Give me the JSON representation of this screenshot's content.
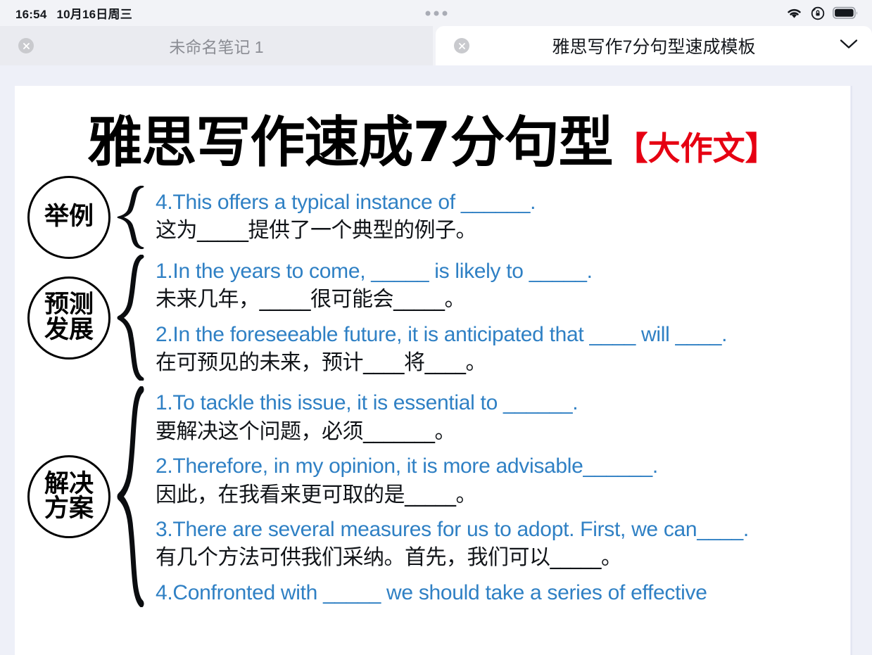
{
  "statusbar": {
    "time": "16:54",
    "date": "10月16日周三",
    "icons": [
      "wifi-icon",
      "rotation-lock-icon",
      "battery-icon"
    ]
  },
  "tabs": [
    {
      "title": "未命名笔记 1",
      "active": false
    },
    {
      "title": "雅思写作7分句型速成模板",
      "active": true
    }
  ],
  "document": {
    "heading_main": "雅思写作速成7分句型",
    "heading_tag": "【大作文】",
    "heading_tag_color": "#e60012",
    "english_color": "#2f80c4",
    "groups": [
      {
        "label_lines": [
          "举例"
        ],
        "lines": [
          {
            "en": "4.This offers a typical instance of ______.",
            "zh": "这为_____提供了一个典型的例子。"
          }
        ]
      },
      {
        "label_lines": [
          "预测",
          "发展"
        ],
        "lines": [
          {
            "en": "1.In the years to come, _____ is likely to _____.",
            "zh": "未来几年，_____很可能会_____。"
          },
          {
            "en": "2.In the foreseeable future, it is anticipated that ____ will ____.",
            "zh": "在可预见的未来，预计____将____。"
          }
        ]
      },
      {
        "label_lines": [
          "解决",
          "方案"
        ],
        "lines": [
          {
            "en": "1.To tackle this issue, it is essential to ______.",
            "zh": "要解决这个问题，必须_______。"
          },
          {
            "en": "2.Therefore, in my opinion, it is more advisable______.",
            "zh": "因此，在我看来更可取的是_____。"
          },
          {
            "en": "3.There are several measures for us to adopt. First, we can____.",
            "zh": "有几个方法可供我们采纳。首先，我们可以_____。"
          },
          {
            "en": "4.Confronted with _____ we should take a series of effective",
            "zh": ""
          }
        ]
      }
    ]
  }
}
